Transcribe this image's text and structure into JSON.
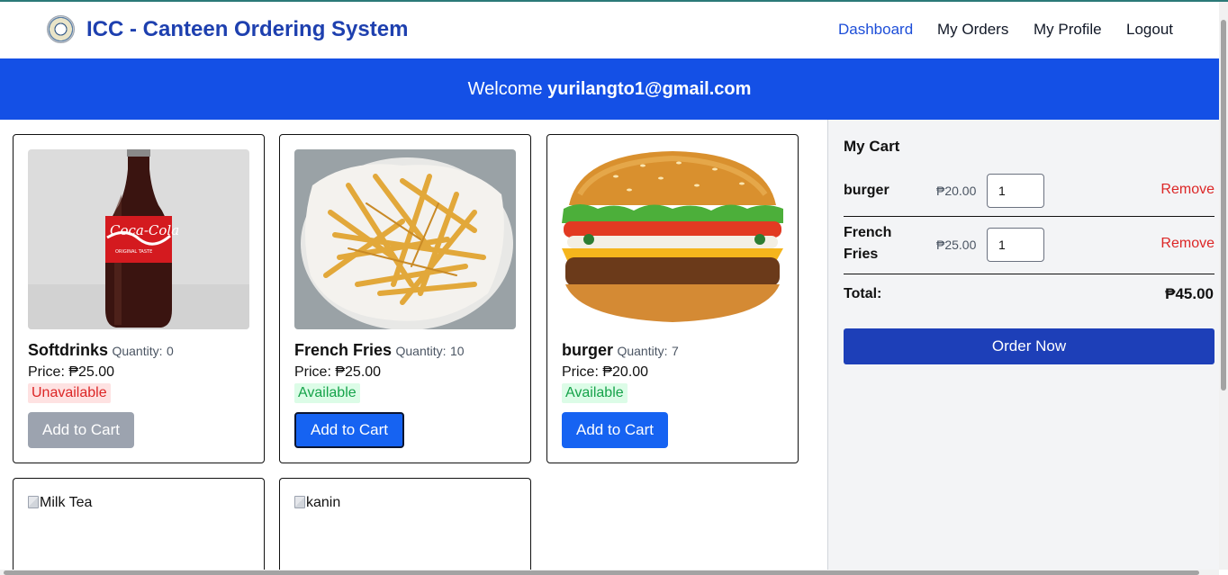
{
  "navbar": {
    "brand": "ICC - Canteen Ordering System",
    "links": [
      "Dashboard",
      "My Orders",
      "My Profile",
      "Logout"
    ],
    "active": "Dashboard"
  },
  "banner": {
    "prefix": "Welcome",
    "user": "yurilangto1@gmail.com"
  },
  "products": [
    {
      "name": "Softdrinks",
      "quantity_label": "Quantity:",
      "quantity": "0",
      "price_label": "Price:",
      "price": "₱25.00",
      "status": "Unavailable",
      "button": "Add to Cart",
      "image": "coca-cola-bottle"
    },
    {
      "name": "French Fries",
      "quantity_label": "Quantity:",
      "quantity": "10",
      "price_label": "Price:",
      "price": "₱25.00",
      "status": "Available",
      "button": "Add to Cart",
      "image": "french-fries"
    },
    {
      "name": "burger",
      "quantity_label": "Quantity:",
      "quantity": "7",
      "price_label": "Price:",
      "price": "₱20.00",
      "status": "Available",
      "button": "Add to Cart",
      "image": "burger"
    },
    {
      "alt": "Milk Tea"
    },
    {
      "alt": "kanin"
    }
  ],
  "cart": {
    "title": "My Cart",
    "items": [
      {
        "name": "burger",
        "price": "₱20.00",
        "qty": "1",
        "remove": "Remove"
      },
      {
        "name": "French Fries",
        "price": "₱25.00",
        "qty": "1",
        "remove": "Remove"
      }
    ],
    "total_label": "Total:",
    "total": "₱45.00",
    "order_button": "Order Now"
  },
  "colors": {
    "brand": "#1e40af",
    "banner": "#1450e6",
    "button": "#1663f2",
    "order_button": "#1d3fb8",
    "remove": "#dc2626",
    "available": "#16a34a",
    "unavailable": "#dc2626"
  }
}
